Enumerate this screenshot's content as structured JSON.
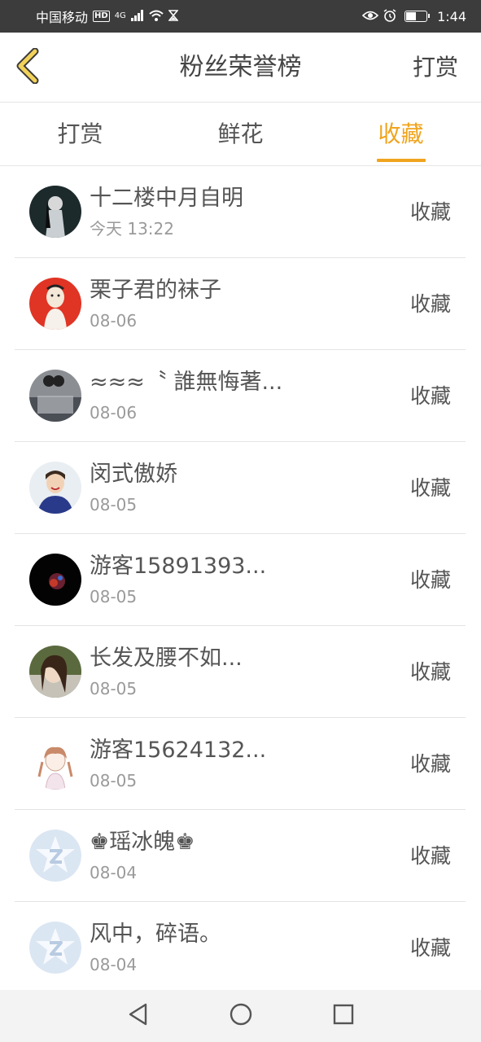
{
  "status_bar": {
    "carrier": "中国移动",
    "hd": "HD",
    "network": "4G",
    "time": "1:44",
    "icons": [
      "signal-icon",
      "wifi-icon",
      "hourglass-icon",
      "eye-icon",
      "alarm-icon",
      "battery-icon"
    ]
  },
  "header": {
    "title": "粉丝荣誉榜",
    "action_label": "打赏",
    "back_icon": "chevron-left-icon",
    "accent_color": "#f0a41e"
  },
  "tabs": [
    {
      "label": "打赏",
      "active": false
    },
    {
      "label": "鲜花",
      "active": false
    },
    {
      "label": "收藏",
      "active": true
    }
  ],
  "fans": [
    {
      "name": "十二楼中月自明",
      "date": "今天 13:22",
      "action": "收藏",
      "avatar": "avatar-photo-dark"
    },
    {
      "name": "栗子君的袜子",
      "date": "08-06",
      "action": "收藏",
      "avatar": "avatar-illustration-red"
    },
    {
      "name": "≈≈≈〝 誰無悔著...",
      "date": "08-06",
      "action": "收藏",
      "avatar": "avatar-photo-grey"
    },
    {
      "name": "闵式傲娇",
      "date": "08-05",
      "action": "收藏",
      "avatar": "avatar-photo-singer"
    },
    {
      "name": "游客15891393...",
      "date": "08-05",
      "action": "收藏",
      "avatar": "avatar-photo-black"
    },
    {
      "name": "长发及腰不如...",
      "date": "08-05",
      "action": "收藏",
      "avatar": "avatar-photo-girl"
    },
    {
      "name": "游客15624132...",
      "date": "08-05",
      "action": "收藏",
      "avatar": "avatar-illustration-girl"
    },
    {
      "name": "♚瑶冰魄♚",
      "date": "08-04",
      "action": "收藏",
      "avatar": "avatar-default-qzone"
    },
    {
      "name": "风中，碎语。",
      "date": "08-04",
      "action": "收藏",
      "avatar": "avatar-default-qzone"
    }
  ],
  "system_nav": [
    "back-triangle-icon",
    "home-circle-icon",
    "recents-square-icon"
  ]
}
